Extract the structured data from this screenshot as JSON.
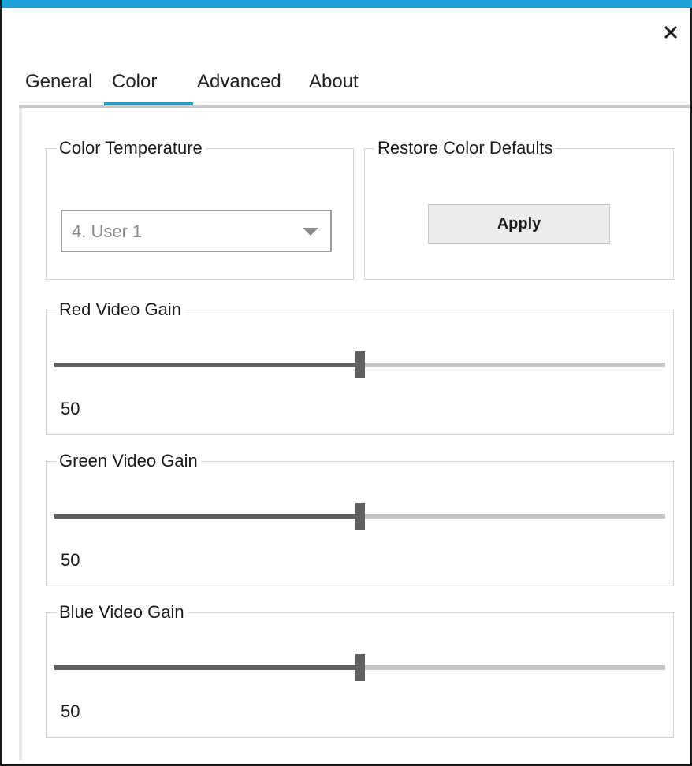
{
  "window": {
    "accent_color": "#1ea0d7",
    "close_icon": "close-icon"
  },
  "tabs": [
    {
      "label": "General",
      "selected": false
    },
    {
      "label": "Color",
      "selected": true
    },
    {
      "label": "Advanced",
      "selected": false
    },
    {
      "label": "About",
      "selected": false
    }
  ],
  "color_temperature": {
    "title": "Color Temperature",
    "selected_value": "4. User 1",
    "icon": "chevron-down-icon"
  },
  "restore_defaults": {
    "title": "Restore Color Defaults",
    "button_label": "Apply"
  },
  "gains": {
    "red": {
      "title": "Red Video Gain",
      "value": "50",
      "fraction": 0.5
    },
    "green": {
      "title": "Green Video Gain",
      "value": "50",
      "fraction": 0.5
    },
    "blue": {
      "title": "Blue Video Gain",
      "value": "50",
      "fraction": 0.5
    }
  }
}
